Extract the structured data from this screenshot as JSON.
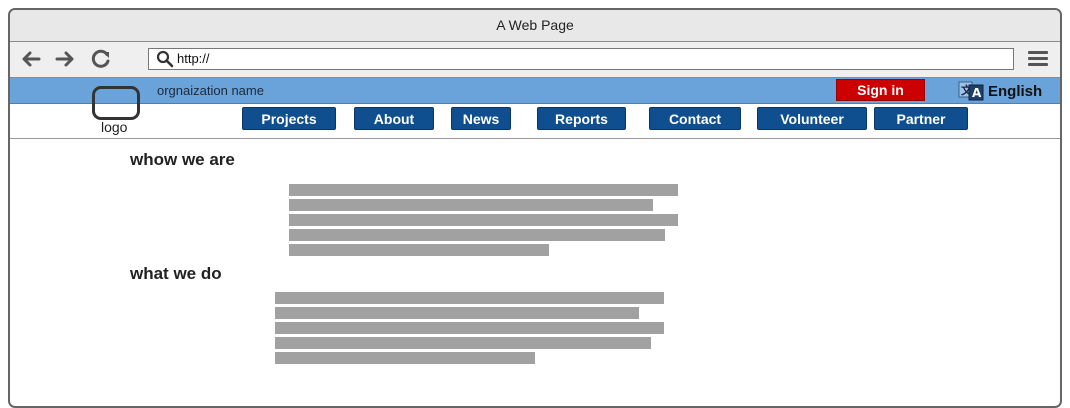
{
  "window": {
    "title": "A Web Page"
  },
  "browser": {
    "url": "http://",
    "icons": [
      "back-arrow-icon",
      "forward-arrow-icon",
      "reload-icon",
      "search-icon",
      "hamburger-menu-icon"
    ]
  },
  "header": {
    "org_name": "orgnaization name",
    "sign_in_label": "Sign in",
    "language_label": "English",
    "logo_label": "logo"
  },
  "nav": {
    "items": [
      {
        "label": "Projects"
      },
      {
        "label": "About"
      },
      {
        "label": "News"
      },
      {
        "label": "Reports"
      },
      {
        "label": "Contact"
      },
      {
        "label": "Volunteer"
      },
      {
        "label": "Partner"
      }
    ]
  },
  "sections": [
    {
      "heading": "whow we are",
      "placeholder_lines": 5
    },
    {
      "heading": "what we do",
      "placeholder_lines": 5
    }
  ],
  "colors": {
    "org_bar": "#6aa3d9",
    "nav_button": "#0f4f8f",
    "sign_in": "#cc0000",
    "placeholder_text": "#a1a1a1"
  }
}
